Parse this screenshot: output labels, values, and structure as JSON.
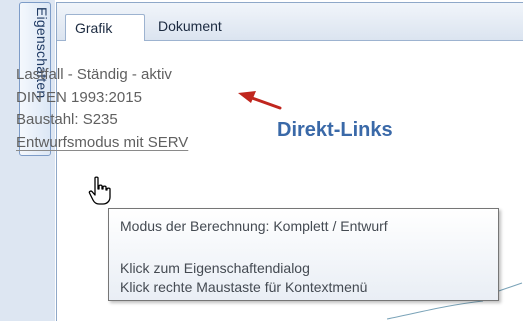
{
  "side_panel": {
    "tab_label": "Eigenschaften"
  },
  "tabs": [
    {
      "label": "Grafik",
      "active": true
    },
    {
      "label": "Dokument",
      "active": false
    }
  ],
  "content": {
    "line1": "Lastfall - Ständig - aktiv",
    "line2": "DIN EN 1993:2015",
    "line3": "Baustahl: S235",
    "link": "Entwurfsmodus mit SERV"
  },
  "annotation": {
    "text": "Direkt-Links",
    "color": "#3a69a8",
    "arrow_color": "#c0261e"
  },
  "tooltip": {
    "line1": "Modus der Berechnung: Komplett / Entwurf",
    "line2": "Klick zum Eigenschaftendialog",
    "line3": "Klick rechte Maustaste für Kontextmenü"
  },
  "icons": {
    "cursor": "hand-pointer-icon",
    "arrow": "red-arrow-icon"
  }
}
